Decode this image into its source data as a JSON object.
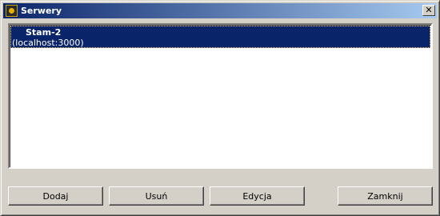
{
  "window": {
    "title": "Serwery"
  },
  "servers": [
    {
      "name": "Stam-2",
      "address": "(localhost:3000)"
    }
  ],
  "buttons": {
    "add": "Dodaj",
    "remove": "Usuń",
    "edit": "Edycja",
    "close": "Zamknij"
  },
  "icons": {
    "app": "app-icon",
    "close": "close-icon"
  },
  "colors": {
    "selection": "#0a246a",
    "window": "#d4d0c8"
  }
}
